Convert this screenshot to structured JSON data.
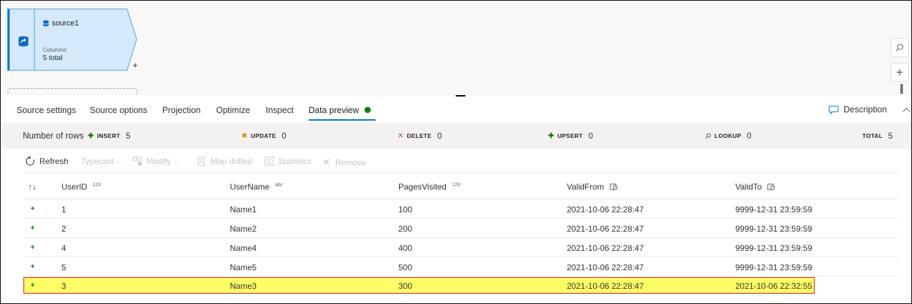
{
  "node": {
    "title": "source1",
    "columns_label": "Columns:",
    "columns_value": "5 total",
    "add_label": "+"
  },
  "canvas": {
    "search_icon": "search-icon",
    "zoom_in_label": "+"
  },
  "tabs": [
    {
      "label": "Source settings"
    },
    {
      "label": "Source options"
    },
    {
      "label": "Projection"
    },
    {
      "label": "Optimize"
    },
    {
      "label": "Inspect"
    },
    {
      "label": "Data preview",
      "active": true
    }
  ],
  "description_label": "Description",
  "stats": {
    "rows_label": "Number of rows",
    "insert": {
      "label": "INSERT",
      "value": "5"
    },
    "update": {
      "label": "UPDATE",
      "value": "0"
    },
    "delete": {
      "label": "DELETE",
      "value": "0"
    },
    "upsert": {
      "label": "UPSERT",
      "value": "0"
    },
    "lookup": {
      "label": "LOOKUP",
      "value": "0"
    },
    "total": {
      "label": "TOTAL",
      "value": "5"
    }
  },
  "toolbar": {
    "refresh": "Refresh",
    "typecast": "Typecast",
    "modify": "Modify",
    "map_drifted": "Map drifted",
    "statistics": "Statistics",
    "remove": "Remove"
  },
  "grid": {
    "sort_icon": "↑↓",
    "columns": [
      {
        "name": "UserID",
        "type": "123"
      },
      {
        "name": "UserName",
        "type": "abc"
      },
      {
        "name": "PagesVisited",
        "type": "123"
      },
      {
        "name": "ValidFrom",
        "type": "datetime-icon"
      },
      {
        "name": "ValidTo",
        "type": "datetime-icon"
      }
    ],
    "row_marker": "+",
    "rows": [
      [
        "1",
        "Name1",
        "100",
        "2021-10-06 22:28:47",
        "9999-12-31 23:59:59"
      ],
      [
        "2",
        "Name2",
        "200",
        "2021-10-06 22:28:47",
        "9999-12-31 23:59:59"
      ],
      [
        "4",
        "Name4",
        "400",
        "2021-10-06 22:28:47",
        "9999-12-31 23:59:59"
      ],
      [
        "5",
        "Name5",
        "500",
        "2021-10-06 22:28:47",
        "9999-12-31 23:59:59"
      ],
      [
        "3",
        "Name3",
        "300",
        "2021-10-06 22:28:47",
        "2021-10-06 22:32:55"
      ]
    ],
    "highlight_color": "#ffff66",
    "highlight_border": "#e81123"
  },
  "colors": {
    "accent": "#0078d4",
    "node_fill": "#d4eafa",
    "status_green": "#107c10"
  }
}
